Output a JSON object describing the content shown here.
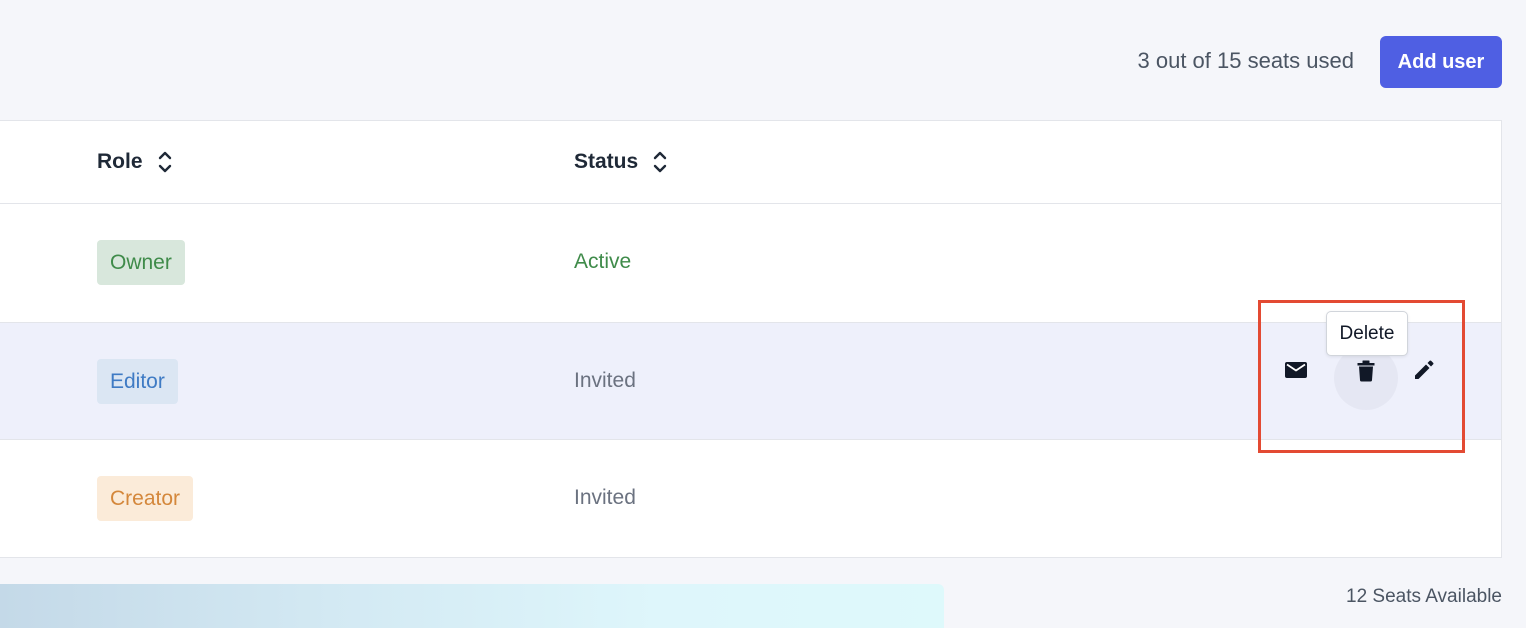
{
  "header": {
    "seats_used": "3 out of 15 seats used",
    "add_user_label": "Add user"
  },
  "table": {
    "columns": [
      "Role",
      "Status"
    ],
    "rows": [
      {
        "role": "Owner",
        "status": "Active"
      },
      {
        "role": "Editor",
        "status": "Invited"
      },
      {
        "role": "Creator",
        "status": "Invited"
      }
    ]
  },
  "actions": {
    "icons": [
      "mail-icon",
      "trash-icon",
      "pencil-icon"
    ],
    "tooltip": "Delete",
    "highlight_color": "#e34a33"
  },
  "footer": {
    "seats_available": "12 Seats Available"
  },
  "colors": {
    "accent": "#4f5fe3",
    "active": "#3f8b4a",
    "owner_badge_bg": "#d8e7dc",
    "editor_badge_bg": "#dbe6f3",
    "creator_badge_bg": "#fbebd9"
  }
}
